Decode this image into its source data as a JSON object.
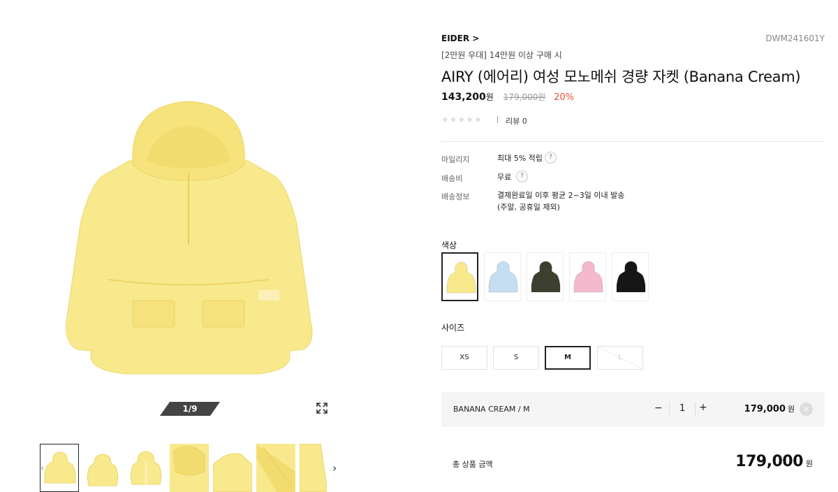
{
  "product": {
    "brand": "EIDER >",
    "sku": "DWM241601Y",
    "promo": "[2만원 우대] 14만원 이상 구매 시",
    "title": "AIRY (에어리) 여성 모노메쉬 경량 자켓 (Banana Cream)",
    "sale_price": "143,200",
    "sale_unit": "원",
    "original_price": "179,000원",
    "discount": "20%",
    "stars": "★★★★★",
    "review": "리뷰 0"
  },
  "gallery": {
    "counter": "1/9",
    "prev_arrow": "‹",
    "next_arrow": "›"
  },
  "info": {
    "mileage_label": "마일리지",
    "mileage_value": "최대 5% 적립",
    "shipping_fee_label": "배송비",
    "shipping_fee_value": "무료",
    "shipping_info_label": "배송정보",
    "shipping_info_line1": "결제완료일 이후 평균 2~3일 이내 발송",
    "shipping_info_line2": "(주말, 공휴일 제외)",
    "help_glyph": "?"
  },
  "colors": {
    "label": "색상",
    "swatches": [
      "#f8e98d",
      "#c5def2",
      "#3d3f2f",
      "#f4b9cc",
      "#161616"
    ]
  },
  "sizes": {
    "label": "사이즈",
    "options": [
      "XS",
      "S",
      "M",
      "L"
    ],
    "selected": "M",
    "disabled": "L"
  },
  "selection": {
    "name": "BANANA CREAM / M",
    "minus": "−",
    "quantity": "1",
    "plus": "+",
    "price": "179,000",
    "unit": "원",
    "remove": "✕"
  },
  "total": {
    "label": "총 상품 금액",
    "price": "179,000",
    "unit": "원"
  }
}
